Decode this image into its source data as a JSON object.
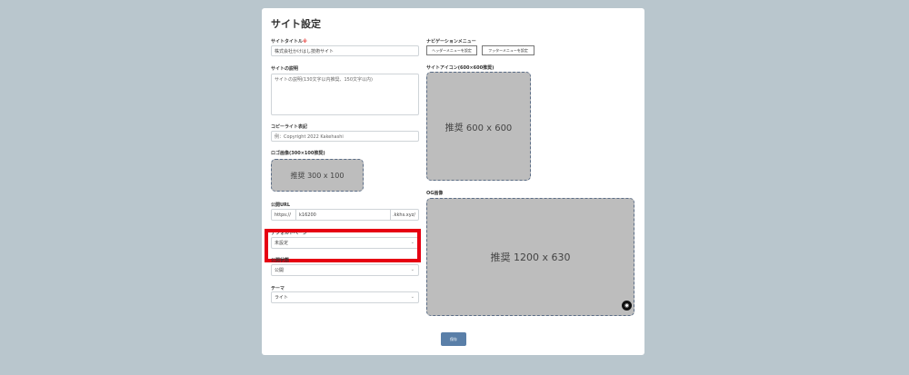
{
  "page": {
    "title": "サイト設定"
  },
  "fields": {
    "site_title": {
      "label": "サイトタイトル",
      "required_mark": "※",
      "value": "株式会社かけはし技術サイト"
    },
    "description": {
      "label": "サイトの説明",
      "placeholder": "サイトの説明(130文字以内推奨、150文字以内)"
    },
    "copyright": {
      "label": "コピーライト表記",
      "placeholder": "例：Copyright 2022 Kakehashi"
    },
    "logo": {
      "label": "ロゴ画像(300×100推奨)",
      "placeholder": "推奨 300 x 100"
    },
    "public_url": {
      "label": "公開URL",
      "prefix": "https://",
      "value": "k16200",
      "suffix": ".kkhs.xyz/"
    },
    "default_page": {
      "label": "デフォルトページ",
      "value": "未設定"
    },
    "status": {
      "label": "公開状態",
      "value": "公開"
    },
    "theme": {
      "label": "テーマ",
      "value": "ライト"
    },
    "nav_menu": {
      "label": "ナビゲーションメニュー",
      "header_button": "ヘッダーメニューを設定",
      "footer_button": "フッターメニューを設定"
    },
    "site_icon": {
      "label": "サイトアイコン(600×600推奨)",
      "placeholder": "推奨 600 x 600"
    },
    "og_image": {
      "label": "OG画像",
      "placeholder": "推奨 1200 x 630"
    }
  },
  "actions": {
    "save_label": "保存"
  },
  "icons": {
    "chevron": "chevron-down-icon",
    "camera": "camera-icon"
  }
}
